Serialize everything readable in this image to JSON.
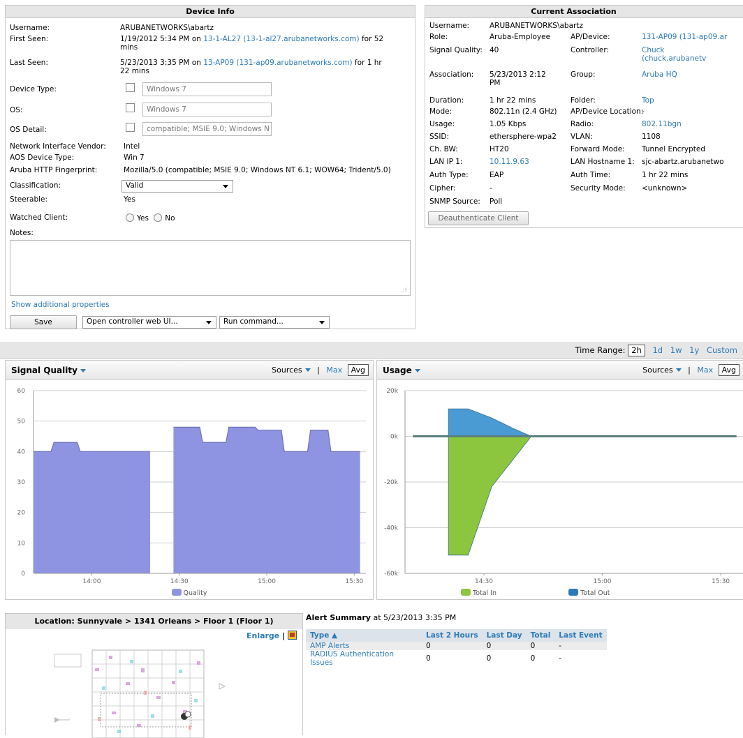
{
  "device_info": {
    "title": "Device Info",
    "username_label": "Username:",
    "username": "ARUBANETWORKS\\abartz",
    "first_seen_label": "First Seen:",
    "first_seen_pre": "1/19/2012 5:34 PM on ",
    "first_seen_link": "13-1-AL27 (13-1-al27.arubanetworks.com)",
    "first_seen_post": " for 52",
    "first_seen_cont": "mins",
    "last_seen_label": "Last Seen:",
    "last_seen_pre": "5/23/2013 3:35 PM on ",
    "last_seen_link": "13-AP09 (131-ap09.arubanetworks.com)",
    "last_seen_post": " for 1 hr",
    "last_seen_cont": "22 mins",
    "device_type_label": "Device Type:",
    "device_type": "Windows 7",
    "os_label": "OS:",
    "os": "Windows 7",
    "os_detail_label": "OS Detail:",
    "os_detail": "compatible; MSIE 9.0; Windows N",
    "vendor_label": "Network Interface Vendor:",
    "vendor": "Intel",
    "aos_label": "AOS Device Type:",
    "aos": "Win 7",
    "fingerprint_label": "Aruba HTTP Fingerprint:",
    "fingerprint": "Mozilla/5.0 (compatible; MSIE 9.0; Windows NT 6.1; WOW64; Trident/5.0)",
    "classification_label": "Classification:",
    "classification": "Valid",
    "steerable_label": "Steerable:",
    "steerable": "Yes",
    "watched_label": "Watched Client:",
    "watched_yes": "Yes",
    "watched_no": "No",
    "notes_label": "Notes:",
    "show_more": "Show additional properties",
    "save": "Save",
    "open_controller": "Open controller web UI...",
    "run_command": "Run command..."
  },
  "assoc": {
    "title": "Current Association",
    "left": [
      {
        "k": "Username:",
        "v": "ARUBANETWORKS\\abartz"
      },
      {
        "k": "Role:",
        "v": "Aruba-Employee"
      },
      {
        "k": "Signal Quality:",
        "v": "40"
      },
      {
        "k": "Association:",
        "v": "5/23/2013 2:12",
        "v2": "PM"
      },
      {
        "k": "Duration:",
        "v": "1 hr 22 mins"
      },
      {
        "k": "Mode:",
        "v": "802.11n (2.4 GHz)"
      },
      {
        "k": "Usage:",
        "v": "1.05 Kbps"
      },
      {
        "k": "SSID:",
        "v": "ethersphere-wpa2"
      },
      {
        "k": "Ch. BW:",
        "v": "HT20"
      },
      {
        "k": "LAN IP 1:",
        "v": "10.11.9.63"
      },
      {
        "k": "Auth Type:",
        "v": "EAP"
      },
      {
        "k": "Cipher:",
        "v": "-"
      },
      {
        "k": "SNMP Source:",
        "v": "Poll"
      }
    ],
    "right": [
      {
        "k": "AP/Device:",
        "v": "131-AP09 (131-ap09.ar"
      },
      {
        "k": "Controller:",
        "v": "Chuck",
        "v2": "(chuck.arubanetv"
      },
      {
        "k": "Group:",
        "v": "Aruba HQ"
      },
      {
        "k": "Folder:",
        "v": "Top"
      },
      {
        "k": "AP/Device Location:",
        "v": "-"
      },
      {
        "k": "Radio:",
        "v": "802.11bgn"
      },
      {
        "k": "VLAN:",
        "v": "1108"
      },
      {
        "k": "Forward Mode:",
        "v": "Tunnel Encrypted"
      },
      {
        "k": "LAN Hostname 1:",
        "v": "sjc-abartz.arubanetwo"
      },
      {
        "k": "Auth Time:",
        "v": "1 hr 22 mins"
      },
      {
        "k": "Security Mode:",
        "v": "<unknown>"
      }
    ],
    "deauth": "Deauthenticate Client"
  },
  "time_range": {
    "label": "Time Range:",
    "options": [
      "2h",
      "1d",
      "1w",
      "1y",
      "Custom"
    ],
    "selected": "2h"
  },
  "charts_ui": {
    "signal": {
      "title": "Signal Quality",
      "sources": "Sources",
      "sep": "|",
      "max": "Max",
      "avg": "Avg",
      "legend": "Quality"
    },
    "usage": {
      "title": "Usage",
      "sources": "Sources",
      "sep": "|",
      "max": "Max",
      "avg": "Avg",
      "legend_in": "Total In",
      "legend_out": "Total Out"
    }
  },
  "chart_data": [
    {
      "type": "area",
      "title": "Signal Quality",
      "ylim": [
        0,
        60
      ],
      "yticks": [
        0,
        10,
        20,
        30,
        40,
        50,
        60
      ],
      "xticks": [
        "14:00",
        "14:30",
        "15:00",
        "15:30"
      ],
      "series": [
        {
          "name": "Quality",
          "color": "#8f94e2",
          "segments": [
            [
              [
                "13:40",
                40
              ],
              [
                "13:46",
                40
              ],
              [
                "13:47",
                43
              ],
              [
                "13:55",
                43
              ],
              [
                "13:56",
                40
              ],
              [
                "14:20",
                40
              ]
            ],
            [
              [
                "14:28",
                48
              ],
              [
                "14:37",
                48
              ],
              [
                "14:38",
                43
              ],
              [
                "14:46",
                43
              ],
              [
                "14:47",
                48
              ],
              [
                "14:56",
                48
              ],
              [
                "14:57",
                47
              ],
              [
                "15:05",
                47
              ],
              [
                "15:06",
                40
              ],
              [
                "15:14",
                40
              ],
              [
                "15:15",
                47
              ],
              [
                "15:21",
                47
              ],
              [
                "15:22",
                40
              ],
              [
                "15:32",
                40
              ]
            ]
          ]
        }
      ]
    },
    {
      "type": "area",
      "title": "Usage",
      "ylim": [
        -60,
        20
      ],
      "yticks": [
        "20k",
        "0k",
        "-20k",
        "-40k",
        "-60k"
      ],
      "xticks": [
        "14:00",
        "14:30",
        "15:00",
        "15:30"
      ],
      "series": [
        {
          "name": "Total Out",
          "color": "#4a9bd4",
          "points": [
            [
              "14:12",
              0
            ],
            [
              "14:21",
              0
            ],
            [
              "14:21",
              12
            ],
            [
              "14:26",
              12
            ],
            [
              "14:32",
              8
            ],
            [
              "14:38",
              3
            ],
            [
              "14:42",
              0
            ],
            [
              "15:34",
              0
            ]
          ]
        },
        {
          "name": "Total In",
          "color": "#8cc63e",
          "points": [
            [
              "14:21",
              0
            ],
            [
              "14:21",
              -52
            ],
            [
              "14:26",
              -52
            ],
            [
              "14:32",
              -22
            ],
            [
              "14:42",
              0
            ]
          ]
        }
      ]
    }
  ],
  "location": {
    "title": "Location: Sunnyvale > 1341 Orleans > Floor 1 (Floor 1)",
    "enlarge": "Enlarge",
    "sep": "|"
  },
  "alerts": {
    "title": "Alert Summary",
    "at": " at 5/23/2013 3:35 PM",
    "columns": [
      "Type ▲",
      "Last 2 Hours",
      "Last Day",
      "Total",
      "Last Event"
    ],
    "rows": [
      [
        "AMP Alerts",
        "0",
        "0",
        "0",
        "-"
      ],
      [
        "RADIUS Authentication Issues",
        "0",
        "0",
        "0",
        "-"
      ]
    ]
  }
}
